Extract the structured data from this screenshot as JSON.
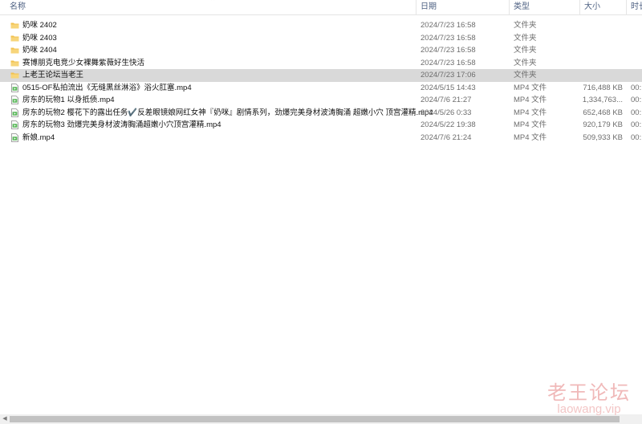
{
  "columns": {
    "name": "名称",
    "date": "日期",
    "type": "类型",
    "size": "大小",
    "duration": "时长"
  },
  "files": [
    {
      "name": "奶咪 2402",
      "date": "2024/7/23 16:58",
      "type": "文件夹",
      "size": "",
      "duration": "",
      "kind": "folder"
    },
    {
      "name": "奶咪 2403",
      "date": "2024/7/23 16:58",
      "type": "文件夹",
      "size": "",
      "duration": "",
      "kind": "folder"
    },
    {
      "name": "奶咪 2404",
      "date": "2024/7/23 16:58",
      "type": "文件夹",
      "size": "",
      "duration": "",
      "kind": "folder"
    },
    {
      "name": "赛博朋克电竞少女裸舞紫薇好生快活",
      "date": "2024/7/23 16:58",
      "type": "文件夹",
      "size": "",
      "duration": "",
      "kind": "folder"
    },
    {
      "name": "上老王论坛当老王",
      "date": "2024/7/23 17:06",
      "type": "文件夹",
      "size": "",
      "duration": "",
      "kind": "folder",
      "selected": true
    },
    {
      "name": "0515-OF私拍流出《无缝黑丝淋浴》浴火肛塞.mp4",
      "date": "2024/5/15 14:43",
      "type": "MP4 文件",
      "size": "716,488 KB",
      "duration": "00:",
      "kind": "video"
    },
    {
      "name": "房东的玩物1 以身抵债.mp4",
      "date": "2024/7/6 21:27",
      "type": "MP4 文件",
      "size": "1,334,763...",
      "duration": "00:",
      "kind": "video"
    },
    {
      "name": "房东的玩物2 樱花下的露出任务✔️反差眼镜娘网红女神『奶咪』剧情系列，劲爆完美身材波涛胸涌 超嫩小穴 顶宫灌精.mp4",
      "date": "2024/5/26 0:33",
      "type": "MP4 文件",
      "size": "652,468 KB",
      "duration": "00:",
      "kind": "video"
    },
    {
      "name": "房东的玩物3 劲爆完美身材波涛胸涌超嫩小穴顶宫灌精.mp4",
      "date": "2024/5/22 19:38",
      "type": "MP4 文件",
      "size": "920,179 KB",
      "duration": "00:",
      "kind": "video"
    },
    {
      "name": "新娘.mp4",
      "date": "2024/7/6 21:24",
      "type": "MP4 文件",
      "size": "509,933 KB",
      "duration": "00:",
      "kind": "video"
    }
  ],
  "watermark": {
    "text": "老王论坛",
    "url": "laowang.vip"
  },
  "colors": {
    "folder": "#f2c14e",
    "video": "#5cb85c",
    "selected_row": "#d9d9d9",
    "header_text": "#4d6082"
  }
}
